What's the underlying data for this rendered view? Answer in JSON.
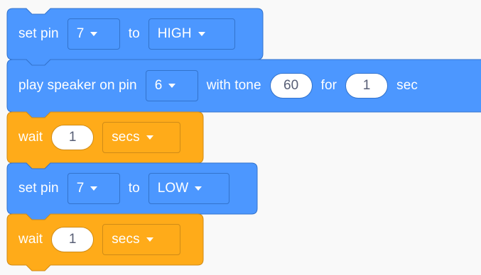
{
  "colors": {
    "motion_block": "#4c97ff",
    "motion_block_edge": "#3373cc",
    "control_block": "#ffab19",
    "control_block_edge": "#cf8b17",
    "background": "#f9f9f9",
    "input_text": "#575e75"
  },
  "blocks": [
    {
      "type": "set_pin",
      "label_set_pin": "set pin",
      "pin": "7",
      "label_to": "to",
      "state": "HIGH"
    },
    {
      "type": "play_speaker",
      "label_play": "play speaker on pin",
      "pin": "6",
      "label_with_tone": "with tone",
      "tone": "60",
      "label_for": "for",
      "duration": "1",
      "label_sec": "sec"
    },
    {
      "type": "wait",
      "label_wait": "wait",
      "amount": "1",
      "unit": "secs"
    },
    {
      "type": "set_pin",
      "label_set_pin": "set pin",
      "pin": "7",
      "label_to": "to",
      "state": "LOW"
    },
    {
      "type": "wait",
      "label_wait": "wait",
      "amount": "1",
      "unit": "secs"
    }
  ],
  "icons": {
    "dropdown_arrow": "dropdown-arrow-icon"
  }
}
